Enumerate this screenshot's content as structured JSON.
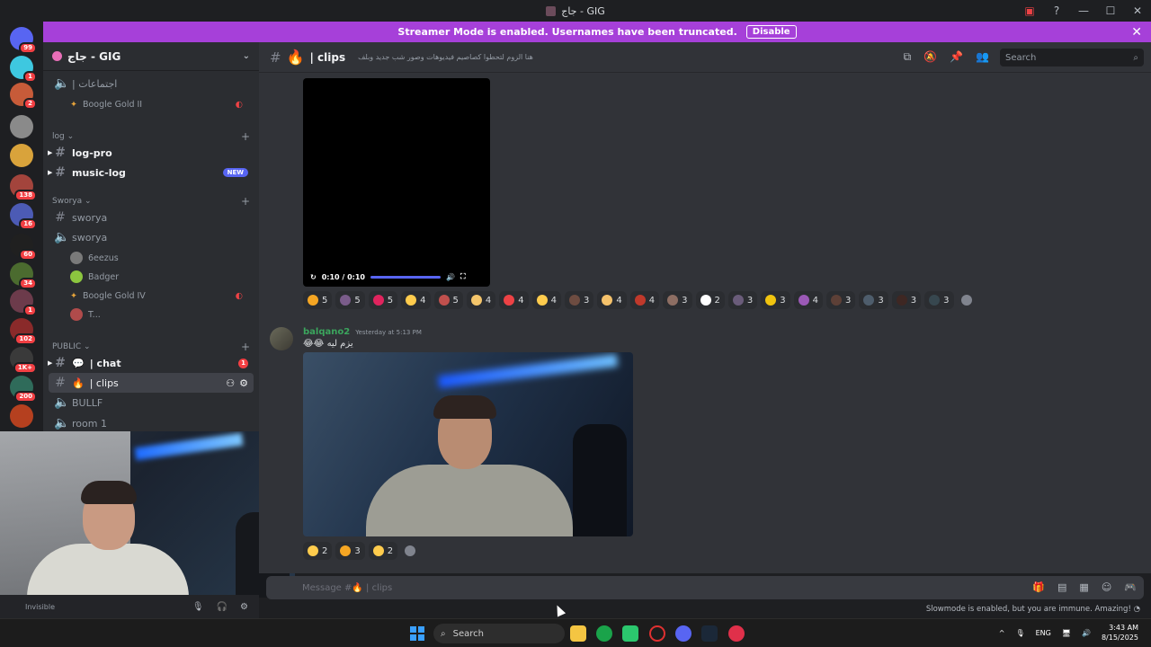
{
  "window": {
    "title": "جاج - GIG"
  },
  "banner": {
    "text": "Streamer Mode is enabled. Usernames have been truncated.",
    "button": "Disable"
  },
  "rail": {
    "badges": [
      "99",
      "1",
      "2",
      "138",
      "16",
      "60",
      "34",
      "1",
      "102",
      "1K+",
      "200"
    ]
  },
  "server": {
    "name": "جاج - GIG"
  },
  "sidebar": {
    "channels": {
      "meetings": "| اجتماعات",
      "log_pro": "log-pro",
      "music_log": "music-log",
      "sworya_text": "sworya",
      "sworya_voice": "sworya",
      "chat": "| chat",
      "clips": "| clips",
      "bullf": "BULLF",
      "room1": "room 1"
    },
    "categories": {
      "log": "log",
      "sworya": "Sworya",
      "public": "PUBLIC"
    },
    "voice_users": {
      "u1": "Boogle Gold II",
      "u2": "6eezus",
      "u3": "Badger",
      "u4": "Boogle Gold IV",
      "u5": "T..."
    },
    "new_badge": "NEW",
    "chat_unread": "1"
  },
  "user_panel": {
    "status": "Invisible"
  },
  "chat_header": {
    "channel": "| clips",
    "topic": "هنا الزوم لتحطوا كصاصيم فيديوهات وصور شب جديد وبلف",
    "search_placeholder": "Search"
  },
  "video": {
    "time": "0:10 / 0:10",
    "progress": 1.0
  },
  "reactions_1": [
    {
      "count": "5",
      "color": "#f5a623"
    },
    {
      "count": "5",
      "color": "#7a5c8a"
    },
    {
      "count": "5",
      "color": "#e0245e"
    },
    {
      "count": "4",
      "color": "#ffcc4d"
    },
    {
      "count": "5",
      "color": "#c0504d"
    },
    {
      "count": "4",
      "color": "#f4c56b"
    },
    {
      "count": "4",
      "color": "#ed4245"
    },
    {
      "count": "4",
      "color": "#ffcc4d"
    },
    {
      "count": "3",
      "color": "#6d4c41"
    },
    {
      "count": "4",
      "color": "#f5c26b"
    },
    {
      "count": "4",
      "color": "#c0392b"
    },
    {
      "count": "3",
      "color": "#8d6e63"
    },
    {
      "count": "2",
      "color": "#ffffff"
    },
    {
      "count": "3",
      "color": "#6a5c7a"
    },
    {
      "count": "3",
      "color": "#f1c40f"
    },
    {
      "count": "4",
      "color": "#9b59b6"
    },
    {
      "count": "3",
      "color": "#5d4037"
    },
    {
      "count": "3",
      "color": "#4e5d6c"
    },
    {
      "count": "3",
      "color": "#3e2723"
    },
    {
      "count": "3",
      "color": "#37474f"
    }
  ],
  "message": {
    "author": "balqano2",
    "time": "Yesterday at 5:13 PM",
    "text": "😂😂 يزم ليه"
  },
  "reactions_2": [
    {
      "count": "2",
      "color": "#ffcc4d"
    },
    {
      "count": "3",
      "color": "#f5a623"
    },
    {
      "count": "2",
      "color": "#ffcc4d"
    }
  ],
  "composer": {
    "placeholder": "Message #🔥 | clips"
  },
  "slowmode": "Slowmode is enabled, but you are immune. Amazing!",
  "taskbar": {
    "search": "Search",
    "lang": "ENG",
    "time": "3:43 AM",
    "date": "8/15/2025"
  }
}
